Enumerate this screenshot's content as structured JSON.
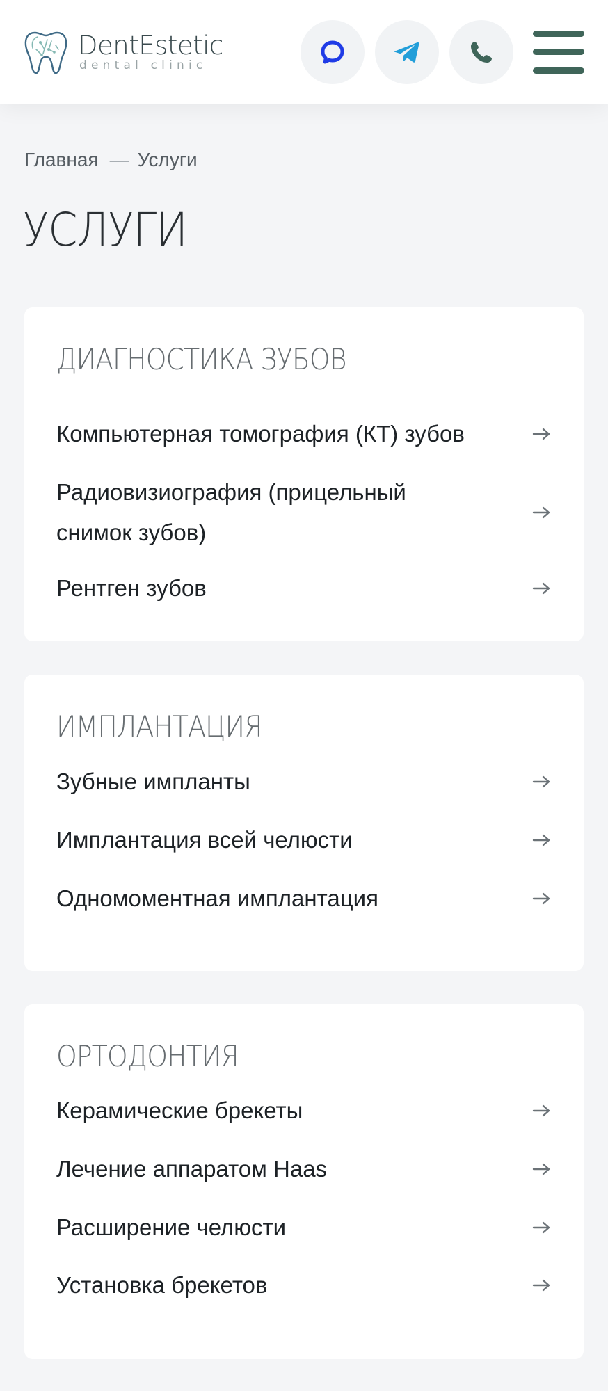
{
  "header": {
    "logo_name": "DentEstetic",
    "logo_sub": "dental clinic",
    "actions": [
      {
        "name": "chat-button",
        "icon": "chat-bubble-icon",
        "color": "#1f3be6"
      },
      {
        "name": "telegram-button",
        "icon": "telegram-icon",
        "color": "#229ed9"
      },
      {
        "name": "phone-button",
        "icon": "phone-icon",
        "color": "#3f6559"
      }
    ],
    "menu_icon": "hamburger-menu-icon",
    "menu_color": "#3f6559"
  },
  "breadcrumb": {
    "home": "Главная",
    "separator": "—",
    "current": "Услуги"
  },
  "page_title": "УСЛУГИ",
  "sections": [
    {
      "title": "ДИАГНОСТИКА ЗУБОВ",
      "items": [
        "Компьютерная томография (КТ) зубов",
        "Радиовизиография (прицельный снимок зубов)",
        "Рентген зубов"
      ]
    },
    {
      "title": "ИМПЛАНТАЦИЯ",
      "items": [
        "Зубные импланты",
        "Имплантация всей челюсти",
        "Одномоментная имплантация"
      ]
    },
    {
      "title": "ОРТОДОНТИЯ",
      "items": [
        "Керамические брекеты",
        "Лечение аппаратом Haas",
        "Расширение челюсти",
        "Установка брекетов"
      ]
    }
  ],
  "colors": {
    "page_bg": "#f4f5f7",
    "card_bg": "#ffffff",
    "accent": "#3f6559",
    "text": "#1d2226",
    "section_title": "#666c70"
  }
}
